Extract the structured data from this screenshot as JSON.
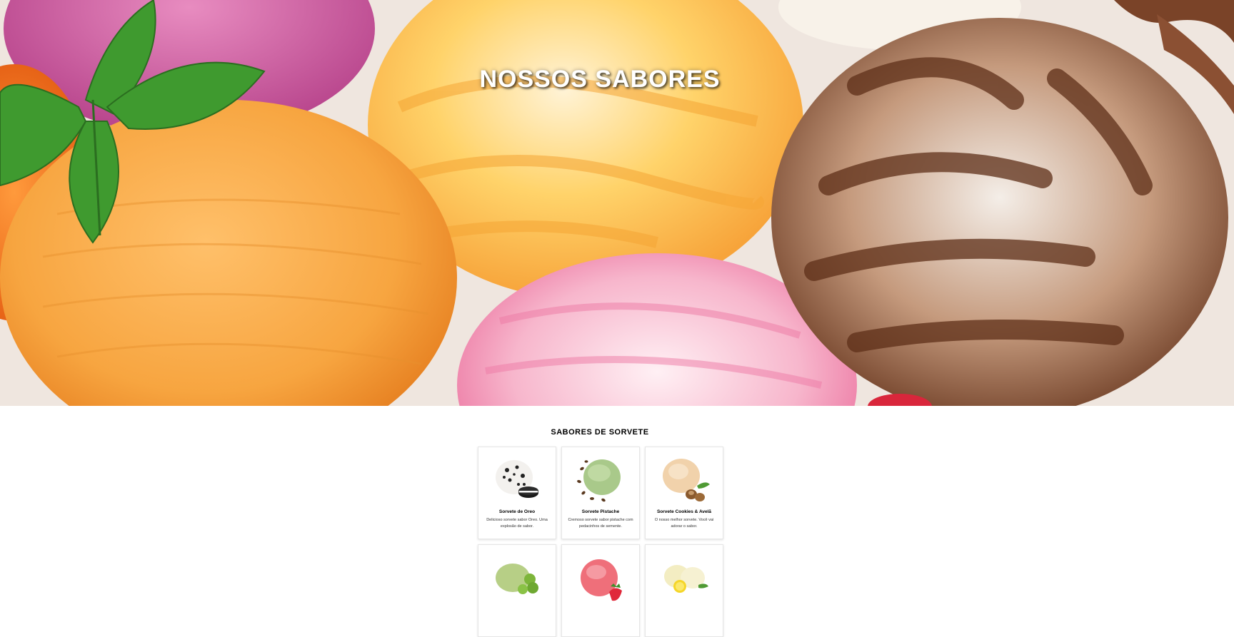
{
  "hero": {
    "title": "NOSSOS SABORES"
  },
  "flavors_section": {
    "title": "SABORES DE SORVETE",
    "cards": [
      {
        "name": "Sorvete de Oreo",
        "description": "Delicioso sorvete sabor Oreo. Uma explosão de sabor.",
        "image": "oreo-ice-cream-scoop"
      },
      {
        "name": "Sorvete Pistache",
        "description": "Cremoso sorvete sabor pistache com pedacinhos de semente.",
        "image": "pistachio-ice-cream-scoop"
      },
      {
        "name": "Sorvete Cookies & Avelã",
        "description": "O nosso melhor sorvete. Você vai adorar o sabor.",
        "image": "cookies-hazelnut-ice-cream-scoop"
      },
      {
        "name": "",
        "description": "",
        "image": "lime-ice-cream-scoop"
      },
      {
        "name": "",
        "description": "",
        "image": "strawberry-ice-cream-scoop"
      },
      {
        "name": "",
        "description": "",
        "image": "lemon-ice-cream-scoops"
      }
    ]
  },
  "colors": {
    "background": "#ffffff",
    "hero_title": "#ffffff",
    "card_border": "#e6e6e6"
  }
}
